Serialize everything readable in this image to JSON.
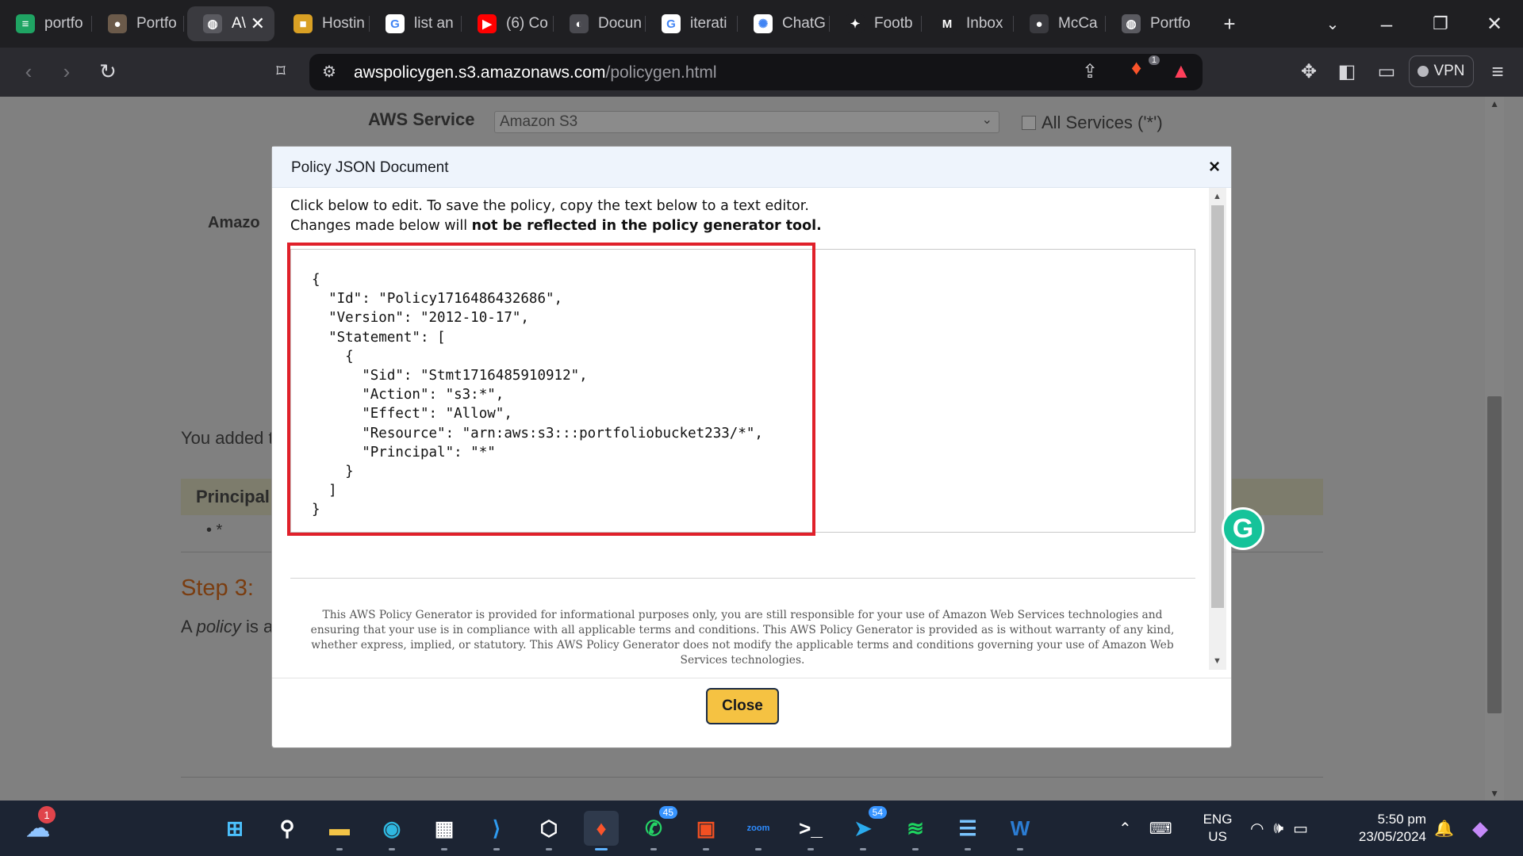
{
  "browser": {
    "tabs": [
      {
        "title": "portfo",
        "icon": "sheet-icon",
        "color": "#1fa463",
        "glyph": "≡"
      },
      {
        "title": "Portfo",
        "icon": "avatar-icon",
        "color": "#6b5a4a",
        "glyph": "●"
      },
      {
        "title": "A\\",
        "icon": "globe-icon",
        "color": "#5a5a60",
        "glyph": "◍",
        "active": true
      },
      {
        "title": "Hostin",
        "icon": "box-icon",
        "color": "#d9a024",
        "glyph": "■"
      },
      {
        "title": "list an",
        "icon": "google-icon",
        "color": "#ffffff",
        "glyph": "G"
      },
      {
        "title": "(6) Co",
        "icon": "youtube-icon",
        "color": "#ff0000",
        "glyph": "▶"
      },
      {
        "title": "Docun",
        "icon": "docs-icon",
        "color": "#4a4a50",
        "glyph": "◐"
      },
      {
        "title": "iterati",
        "icon": "google-icon",
        "color": "#ffffff",
        "glyph": "G"
      },
      {
        "title": "ChatG",
        "icon": "chatgpt-icon",
        "color": "#ffffff",
        "glyph": "✺"
      },
      {
        "title": "Footb",
        "icon": "football-icon",
        "color": "#1f1f22",
        "glyph": "✦"
      },
      {
        "title": "Inbox",
        "icon": "gmail-icon",
        "color": "#1f1f22",
        "glyph": "M"
      },
      {
        "title": "McCa",
        "icon": "github-icon",
        "color": "#3a3a3f",
        "glyph": "●"
      },
      {
        "title": "Portfo",
        "icon": "globe-icon",
        "color": "#5a5a60",
        "glyph": "◍"
      }
    ],
    "close_tab": "✕",
    "new_tab": "+",
    "url_host": "awspolicygen.s3.amazonaws.com",
    "url_path": "/policygen.html",
    "brave_badge": "1",
    "vpn_label": "VPN"
  },
  "page": {
    "aws_service_label": "AWS Service",
    "aws_service_value": "Amazon S3",
    "all_services_label": "All Services ('*')",
    "truncated_label": "Amazo",
    "added_text": "You added t",
    "principal_header": "Principal",
    "principal_value": "• *",
    "step3": "Step 3:",
    "policy_prefix": "A ",
    "policy_word": "policy",
    "policy_suffix": " is a"
  },
  "modal": {
    "title": "Policy JSON Document",
    "close_x": "×",
    "instruction_line1": "Click below to edit. To save the policy, copy the text below to a text editor.",
    "instruction_line2_prefix": "Changes made below will ",
    "instruction_line2_bold": "not be reflected in the policy generator tool.",
    "json_text": "{\n  \"Id\": \"Policy1716486432686\",\n  \"Version\": \"2012-10-17\",\n  \"Statement\": [\n    {\n      \"Sid\": \"Stmt1716485910912\",\n      \"Action\": \"s3:*\",\n      \"Effect\": \"Allow\",\n      \"Resource\": \"arn:aws:s3:::portfoliobucket233/*\",\n      \"Principal\": \"*\"\n    }\n  ]\n}",
    "disclaimer": "This AWS Policy Generator is provided for informational purposes only, you are still responsible for your use of Amazon Web Services technologies and ensuring that your use is in compliance with all applicable terms and conditions. This AWS Policy Generator is provided as is without warranty of any kind, whether express, implied, or statutory. This AWS Policy Generator does not modify the applicable terms and conditions governing your use of Amazon Web Services technologies.",
    "close_button": "Close",
    "highlight_color": "#e0202a"
  },
  "grammarly_letter": "G",
  "taskbar": {
    "weather_badge": "1",
    "apps": [
      {
        "name": "start-icon",
        "glyph": "⊞",
        "color": "#4cc2ff"
      },
      {
        "name": "search-icon",
        "glyph": "⚲",
        "color": "#ffffff"
      },
      {
        "name": "file-explorer-icon",
        "glyph": "▬",
        "color": "#f3c447"
      },
      {
        "name": "edge-icon",
        "glyph": "◉",
        "color": "#2fb8e0"
      },
      {
        "name": "store-icon",
        "glyph": "▦",
        "color": "#ffffff"
      },
      {
        "name": "vscode-icon",
        "glyph": "⟩",
        "color": "#2f9bf0"
      },
      {
        "name": "box3d-icon",
        "glyph": "⬡",
        "color": "#ffffff"
      },
      {
        "name": "brave-icon",
        "glyph": "♦",
        "color": "#fb542b",
        "active": true
      },
      {
        "name": "whatsapp-icon",
        "glyph": "✆",
        "color": "#25d366",
        "badge": "45"
      },
      {
        "name": "office-icon",
        "glyph": "▣",
        "color": "#f25022"
      },
      {
        "name": "zoom-icon",
        "glyph": "zoom",
        "color": "#2d8cff"
      },
      {
        "name": "terminal-icon",
        "glyph": ">_",
        "color": "#ffffff"
      },
      {
        "name": "telegram-icon",
        "glyph": "➤",
        "color": "#2aabee",
        "badge": "54"
      },
      {
        "name": "spotify-icon",
        "glyph": "≋",
        "color": "#1ed760"
      },
      {
        "name": "notepad-icon",
        "glyph": "☰",
        "color": "#7ac5ff"
      },
      {
        "name": "word-icon",
        "glyph": "W",
        "color": "#2b7cd3"
      }
    ],
    "lang_line1": "ENG",
    "lang_line2": "US",
    "time": "5:50 pm",
    "date": "23/05/2024"
  }
}
